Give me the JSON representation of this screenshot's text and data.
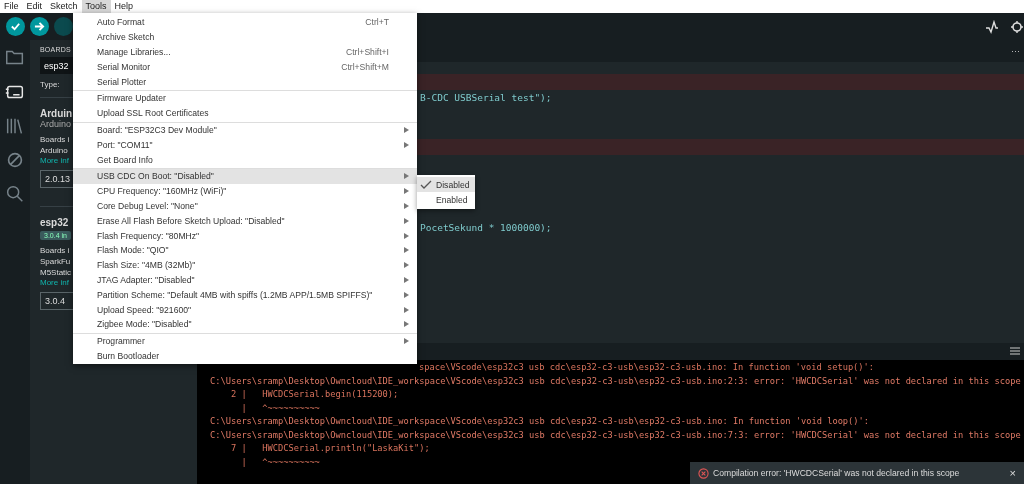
{
  "menubar": [
    {
      "label": "File",
      "selected": false
    },
    {
      "label": "Edit",
      "selected": false
    },
    {
      "label": "Sketch",
      "selected": false
    },
    {
      "label": "Tools",
      "selected": true
    },
    {
      "label": "Help",
      "selected": false
    }
  ],
  "sidebar": {
    "items": [
      {
        "kind": "folder",
        "selected": false
      },
      {
        "kind": "boards",
        "selected": true
      },
      {
        "kind": "library",
        "selected": false
      },
      {
        "kind": "debug",
        "selected": false
      },
      {
        "kind": "search",
        "selected": false
      }
    ]
  },
  "boards_panel": {
    "header": "BOARDS",
    "search_value": "esp32",
    "filter_label": "Type:",
    "cards": [
      {
        "title": "Arduin",
        "author": "Arduino",
        "description": [
          "Boards i",
          "Arduino"
        ],
        "link": "More inf",
        "version": "2.0.13"
      },
      {
        "title": "esp32",
        "badge": "3.0.4 in",
        "description": [
          "Boards i",
          "SparkFu",
          "M5Static"
        ],
        "link": "More inf",
        "version": "3.0.4"
      }
    ]
  },
  "editor": {
    "more": "···",
    "lines": [
      {
        "kind": "error"
      },
      {
        "kind": "code",
        "text": "B-CDC USBSerial test\");"
      },
      {
        "kind": "blank"
      },
      {
        "kind": "blank"
      },
      {
        "kind": "error"
      },
      {
        "kind": "blank"
      },
      {
        "kind": "blank"
      },
      {
        "kind": "blank"
      },
      {
        "kind": "blank"
      },
      {
        "kind": "code",
        "text": "PocetSekund * 1000000);"
      }
    ]
  },
  "console": {
    "lines": [
      {
        "kind": "partial",
        "text": "space\\VScode\\esp32c3 usb cdc\\esp32-c3-usb\\esp32-c3-usb.ino: In function 'void setup()':"
      },
      {
        "kind": "path",
        "text": "C:\\Users\\sramp\\Desktop\\Owncloud\\IDE_workspace\\VScode\\esp32c3 usb cdc\\esp32-c3-usb\\esp32-c3-usb.ino:2:3: error: 'HWCDCSerial' was not declared in this scope"
      },
      {
        "kind": "code",
        "text": "    2 |   HWCDCSerial.begin(115200);"
      },
      {
        "kind": "code",
        "text": "      |   ^~~~~~~~~~~"
      },
      {
        "kind": "path",
        "text": "C:\\Users\\sramp\\Desktop\\Owncloud\\IDE_workspace\\VScode\\esp32c3 usb cdc\\esp32-c3-usb\\esp32-c3-usb.ino: In function 'void loop()':"
      },
      {
        "kind": "path",
        "text": "C:\\Users\\sramp\\Desktop\\Owncloud\\IDE_workspace\\VScode\\esp32c3 usb cdc\\esp32-c3-usb\\esp32-c3-usb.ino:7:3: error: 'HWCDCSerial' was not declared in this scope"
      },
      {
        "kind": "code",
        "text": "    7 |   HWCDCSerial.println(\"LaskaKit\");"
      },
      {
        "kind": "code",
        "text": "      |   ^~~~~~~~~~~"
      }
    ]
  },
  "toast": {
    "message": "Compilation error: 'HWCDCSerial' was not declared in this scope",
    "close": "×"
  },
  "tools_menu": {
    "groups": [
      [
        {
          "label": "Auto Format",
          "shortcut": "Ctrl+T",
          "submenu": false,
          "highlighted": false
        },
        {
          "label": "Archive Sketch",
          "submenu": false,
          "highlighted": false
        },
        {
          "label": "Manage Libraries...",
          "shortcut": "Ctrl+Shift+I",
          "submenu": false,
          "highlighted": false
        },
        {
          "label": "Serial Monitor",
          "shortcut": "Ctrl+Shift+M",
          "submenu": false,
          "highlighted": false
        },
        {
          "label": "Serial Plotter",
          "submenu": false,
          "highlighted": false
        }
      ],
      [
        {
          "label": "Firmware Updater",
          "submenu": false,
          "highlighted": false
        },
        {
          "label": "Upload SSL Root Certificates",
          "submenu": false,
          "highlighted": false
        }
      ],
      [
        {
          "label": "Board: \"ESP32C3 Dev Module\"",
          "submenu": true,
          "highlighted": false
        },
        {
          "label": "Port: \"COM11\"",
          "submenu": true,
          "highlighted": false
        },
        {
          "label": "Get Board Info",
          "submenu": false,
          "highlighted": false
        }
      ],
      [
        {
          "label": "USB CDC On Boot: \"Disabled\"",
          "submenu": true,
          "highlighted": true
        },
        {
          "label": "CPU Frequency: \"160MHz (WiFi)\"",
          "submenu": true,
          "highlighted": false
        },
        {
          "label": "Core Debug Level: \"None\"",
          "submenu": true,
          "highlighted": false
        },
        {
          "label": "Erase All Flash Before Sketch Upload: \"Disabled\"",
          "submenu": true,
          "highlighted": false
        },
        {
          "label": "Flash Frequency: \"80MHz\"",
          "submenu": true,
          "highlighted": false
        },
        {
          "label": "Flash Mode: \"QIO\"",
          "submenu": true,
          "highlighted": false
        },
        {
          "label": "Flash Size: \"4MB (32Mb)\"",
          "submenu": true,
          "highlighted": false
        },
        {
          "label": "JTAG Adapter: \"Disabled\"",
          "submenu": true,
          "highlighted": false
        },
        {
          "label": "Partition Scheme: \"Default 4MB with spiffs (1.2MB APP/1.5MB SPIFFS)\"",
          "submenu": true,
          "highlighted": false
        },
        {
          "label": "Upload Speed: \"921600\"",
          "submenu": true,
          "highlighted": false
        },
        {
          "label": "Zigbee Mode: \"Disabled\"",
          "submenu": true,
          "highlighted": false
        }
      ],
      [
        {
          "label": "Programmer",
          "submenu": true,
          "highlighted": false
        },
        {
          "label": "Burn Bootloader",
          "submenu": false,
          "highlighted": false
        }
      ]
    ]
  },
  "submenu": {
    "items": [
      {
        "label": "Disabled",
        "checked": true
      },
      {
        "label": "Enabled",
        "checked": false
      }
    ]
  }
}
